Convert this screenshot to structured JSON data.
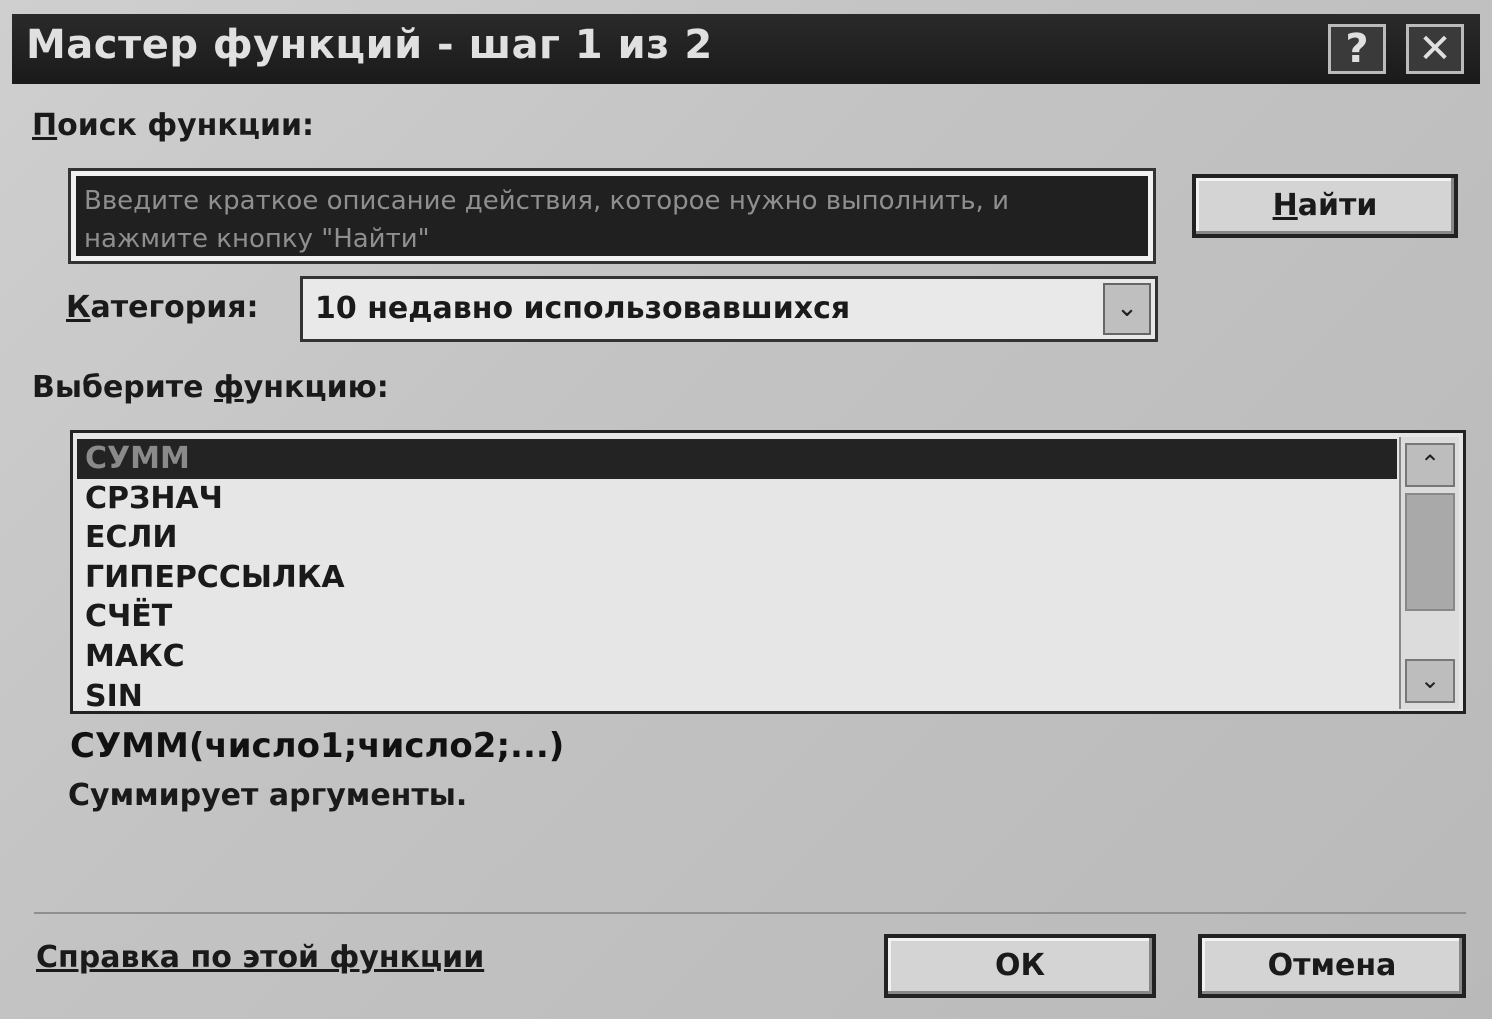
{
  "window": {
    "title": "Мастер функций - шаг 1 из 2",
    "help_btn": "?",
    "close_btn": "✕"
  },
  "search": {
    "label_accel": "П",
    "label_rest": "оиск функции:",
    "placeholder": "Введите краткое описание действия, которое нужно выполнить, и нажмите кнопку \"Найти\"",
    "find_accel": "Н",
    "find_rest": "айти"
  },
  "category": {
    "label_accel": "К",
    "label_rest": "атегория:",
    "selected": "10 недавно использовавшихся",
    "arrow": "⌄"
  },
  "function_list": {
    "label_pre": "Выберите ",
    "label_accel": "ф",
    "label_rest": "ункцию:",
    "items": [
      "СУММ",
      "СРЗНАЧ",
      "ЕСЛИ",
      "ГИПЕРССЫЛКА",
      "СЧЁТ",
      "МАКС",
      "SIN"
    ],
    "selected_index": 0,
    "scroll_up": "⌃",
    "scroll_down": "⌄"
  },
  "details": {
    "signature": "СУММ(число1;число2;...)",
    "description": "Суммирует аргументы."
  },
  "footer": {
    "help_link": "Справка по этой функции",
    "ok": "ОК",
    "cancel": "Отмена"
  }
}
